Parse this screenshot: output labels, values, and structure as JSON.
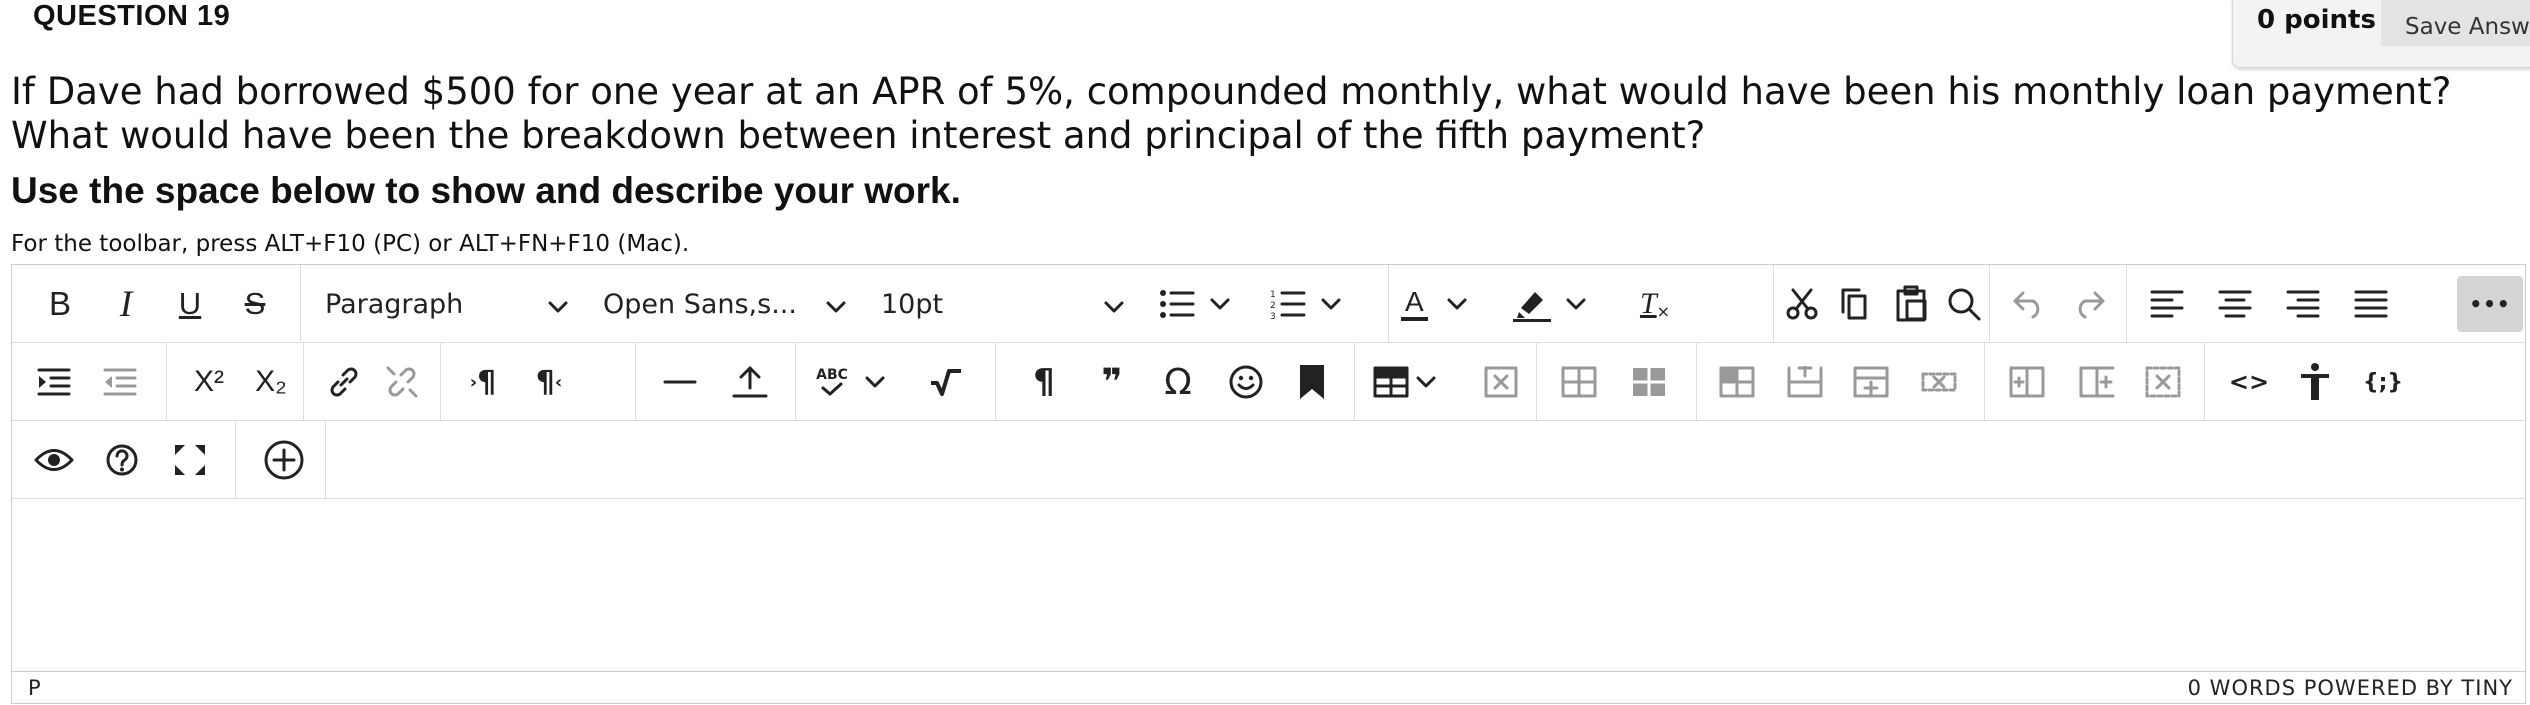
{
  "question": {
    "title": "QUESTION 19",
    "text": "If Dave had borrowed $500 for one year at an APR of 5%, compounded monthly, what would have been his monthly loan payment? What would have been the breakdown between interest and principal of the fifth payment?",
    "instruction": "Use the space below to show and describe your work."
  },
  "header": {
    "points": "0 points",
    "save_label": "Save Answe"
  },
  "editor": {
    "toolbar_hint": "For the toolbar, press ALT+F10 (PC) or ALT+FN+F10 (Mac).",
    "block_format": "Paragraph",
    "font_family": "Open Sans,s...",
    "font_size": "10pt",
    "icons": {
      "bold": "B",
      "italic": "I",
      "underline": "U",
      "strikethrough": "S",
      "font_color": "A",
      "clear_format": "T",
      "superscript": "X²",
      "subscript": "X₂",
      "ltr": "¶",
      "rtl": "¶",
      "paragraph": "¶",
      "blockquote": "❞",
      "omega": "Ω",
      "code": "<>",
      "template": "{;}",
      "more": "•••",
      "spellcheck": "ABC"
    },
    "status_path": "P",
    "status_right": "0 WORDS  POWERED BY TINY"
  }
}
